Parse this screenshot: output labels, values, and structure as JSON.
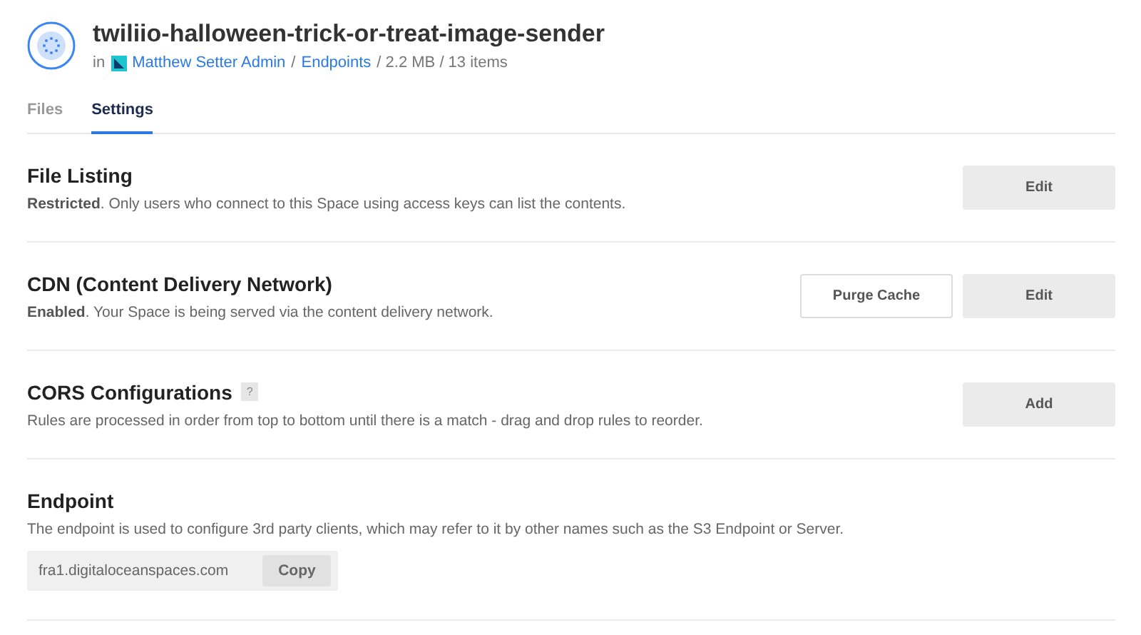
{
  "header": {
    "title": "twiliio-halloween-trick-or-treat-image-sender",
    "prefix": "in",
    "breadcrumb": [
      {
        "kind": "link",
        "text": "Matthew Setter Admin"
      },
      {
        "kind": "text",
        "text": "/"
      },
      {
        "kind": "link",
        "text": "Endpoints"
      },
      {
        "kind": "text",
        "text": "/ 2.2 MB / 13 items"
      }
    ]
  },
  "tabs": [
    {
      "label": "Files",
      "selected": false
    },
    {
      "label": "Settings",
      "selected": true
    }
  ],
  "sections": [
    {
      "title": "File Listing",
      "description": "**Restricted**. Only users who connect to this Space using access keys can list the contents.",
      "buttons": [
        {
          "label": "Edit",
          "kind": "filled"
        }
      ]
    },
    {
      "title": "CDN (Content Delivery Network)",
      "description": "**Enabled**. Your Space is being served via the content delivery network.",
      "buttons": [
        {
          "label": "Purge Cache",
          "kind": "outline"
        },
        {
          "label": "Edit",
          "kind": "filled"
        }
      ]
    },
    {
      "title": "CORS Configurations",
      "help": "?",
      "description": "Rules are processed in order from top to bottom until there is a match - drag and drop rules to reorder.",
      "buttons": [
        {
          "label": "Add",
          "kind": "filled"
        }
      ]
    },
    {
      "title": "Endpoint",
      "description": "The endpoint is used to configure 3rd party clients, which may refer to it by other names such as the S3 Endpoint or Server.",
      "field": {
        "value": "fra1.digitaloceanspaces.com",
        "button": "Copy"
      }
    }
  ]
}
